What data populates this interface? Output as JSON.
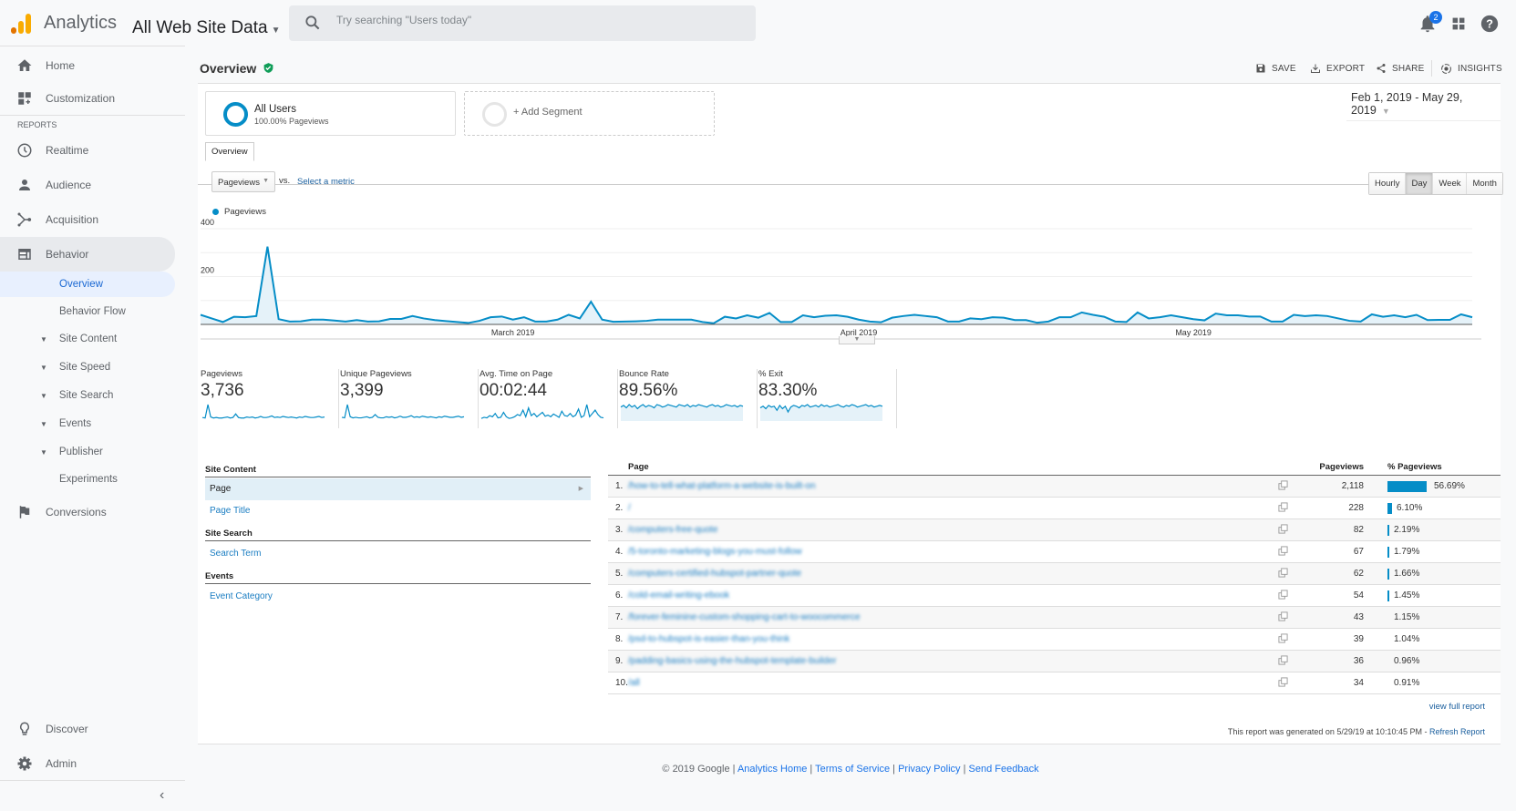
{
  "topbar": {
    "app_name": "Analytics",
    "view_name": "All Web Site Data",
    "search_placeholder": "Try searching \"Users today\"",
    "notification_count": "2",
    "icons": [
      "bell-icon",
      "apps-grid-icon",
      "help-icon"
    ]
  },
  "sidebar": {
    "top_items": [
      {
        "label": "Home",
        "icon": "home-icon"
      },
      {
        "label": "Customization",
        "icon": "dashboard-plus-icon"
      }
    ],
    "reports_label": "REPORTS",
    "report_items": [
      {
        "label": "Realtime",
        "icon": "clock-icon"
      },
      {
        "label": "Audience",
        "icon": "person-icon"
      },
      {
        "label": "Acquisition",
        "icon": "fork-icon"
      },
      {
        "label": "Behavior",
        "icon": "layout-icon"
      }
    ],
    "behavior_sub": [
      {
        "label": "Overview",
        "active": true
      },
      {
        "label": "Behavior Flow"
      }
    ],
    "behavior_groups": [
      "Site Content",
      "Site Speed",
      "Site Search",
      "Events",
      "Publisher"
    ],
    "experiments_label": "Experiments",
    "conversions_label": "Conversions",
    "bottom_items": [
      {
        "label": "Discover",
        "icon": "lightbulb-icon"
      },
      {
        "label": "Admin",
        "icon": "gear-icon"
      }
    ]
  },
  "header": {
    "title": "Overview",
    "actions": [
      {
        "label": "SAVE",
        "icon": "save-icon"
      },
      {
        "label": "EXPORT",
        "icon": "export-icon"
      },
      {
        "label": "SHARE",
        "icon": "share-icon"
      },
      {
        "label": "INSIGHTS",
        "icon": "insights-icon"
      }
    ]
  },
  "segments": {
    "active": {
      "name": "All Users",
      "detail": "100.00% Pageviews",
      "color": "#058dc7"
    },
    "add_label": "+ Add Segment"
  },
  "date_range": "Feb 1, 2019 - May 29, 2019",
  "tab_label": "Overview",
  "metric_selector": {
    "selected": "Pageviews",
    "vs": "vs.",
    "select_metric": "Select a metric"
  },
  "granularity": {
    "options": [
      "Hourly",
      "Day",
      "Week",
      "Month"
    ],
    "selected": "Day"
  },
  "chart_data": {
    "type": "area",
    "title": "",
    "legend": [
      "Pageviews"
    ],
    "legend_position": "top-left",
    "series_color": "#058dc7",
    "ylim": [
      0,
      400
    ],
    "yticks": [
      "400",
      "200"
    ],
    "xticks": [
      "March 2019",
      "April 2019",
      "May 2019"
    ],
    "xtick_indices": [
      28,
      59,
      89
    ],
    "grid": true,
    "series": [
      {
        "name": "Pageviews",
        "values": [
          40,
          25,
          10,
          32,
          30,
          35,
          325,
          22,
          12,
          13,
          20,
          20,
          16,
          12,
          18,
          12,
          13,
          23,
          23,
          35,
          25,
          18,
          14,
          10,
          6,
          15,
          30,
          33,
          20,
          30,
          12,
          12,
          20,
          40,
          25,
          95,
          20,
          11,
          12,
          13,
          15,
          20,
          20,
          20,
          20,
          10,
          5,
          32,
          25,
          38,
          28,
          48,
          10,
          10,
          38,
          30,
          36,
          38,
          32,
          20,
          12,
          9,
          28,
          35,
          40,
          35,
          30,
          12,
          12,
          25,
          22,
          30,
          28,
          18,
          18,
          7,
          12,
          30,
          30,
          50,
          40,
          32,
          12,
          10,
          50,
          25,
          30,
          38,
          30,
          22,
          17,
          45,
          38,
          38,
          33,
          33,
          12,
          12,
          40,
          35,
          38,
          35,
          25,
          15,
          12,
          42,
          32,
          38,
          30,
          40,
          18,
          19,
          19,
          42,
          30
        ]
      }
    ]
  },
  "scorecards": [
    {
      "label": "Pageviews",
      "value": "3,736",
      "spark": [
        5,
        4,
        30,
        6,
        4,
        5,
        4,
        4,
        5,
        6,
        4,
        5,
        12,
        5,
        4,
        4,
        6,
        5,
        6,
        4,
        5,
        7,
        5,
        5,
        6,
        8,
        5,
        6,
        5,
        7,
        6,
        5,
        6,
        5,
        4,
        6,
        5,
        7,
        6,
        5,
        5,
        6,
        7,
        5,
        6
      ],
      "fill": false
    },
    {
      "label": "Unique Pageviews",
      "value": "3,399",
      "spark": [
        5,
        4,
        28,
        6,
        4,
        5,
        4,
        4,
        5,
        6,
        4,
        5,
        10,
        5,
        4,
        4,
        6,
        5,
        6,
        4,
        5,
        7,
        5,
        5,
        6,
        8,
        5,
        6,
        5,
        7,
        6,
        5,
        6,
        5,
        4,
        6,
        5,
        7,
        6,
        5,
        5,
        6,
        7,
        5,
        6
      ],
      "fill": false
    },
    {
      "label": "Avg. Time on Page",
      "value": "00:02:44",
      "spark": [
        3,
        5,
        4,
        8,
        6,
        12,
        4,
        5,
        14,
        6,
        3,
        4,
        6,
        10,
        8,
        18,
        6,
        22,
        8,
        12,
        6,
        10,
        14,
        7,
        9,
        6,
        11,
        8,
        5,
        16,
        8,
        7,
        12,
        6,
        9,
        20,
        5,
        8,
        28,
        6,
        12,
        18,
        10,
        5,
        4
      ],
      "fill": false
    },
    {
      "label": "Bounce Rate",
      "value": "89.56%",
      "spark": [
        16,
        18,
        15,
        19,
        16,
        18,
        14,
        17,
        19,
        16,
        18,
        17,
        15,
        19,
        18,
        16,
        17,
        19,
        18,
        17,
        16,
        19,
        18,
        17,
        19,
        16,
        18,
        17,
        19,
        18,
        17,
        16,
        18,
        19,
        17,
        18,
        16,
        17,
        19,
        18,
        17,
        18,
        16,
        18,
        17
      ],
      "fill": true
    },
    {
      "label": "% Exit",
      "value": "83.30%",
      "spark": [
        15,
        17,
        14,
        18,
        16,
        17,
        12,
        18,
        14,
        17,
        10,
        16,
        18,
        17,
        15,
        18,
        17,
        19,
        16,
        17,
        18,
        16,
        19,
        17,
        18,
        16,
        17,
        18,
        19,
        17,
        16,
        18,
        17,
        19,
        18,
        16,
        17,
        18,
        19,
        17,
        18,
        16,
        17,
        18,
        17
      ],
      "fill": true
    }
  ],
  "dimensions": {
    "groups": [
      {
        "heading": "Site Content",
        "items": [
          {
            "label": "Page",
            "selected": true
          },
          {
            "label": "Page Title"
          }
        ]
      },
      {
        "heading": "Site Search",
        "items": [
          {
            "label": "Search Term"
          }
        ]
      },
      {
        "heading": "Events",
        "items": [
          {
            "label": "Event Category"
          }
        ]
      }
    ]
  },
  "table": {
    "columns": [
      "Page",
      "Pageviews",
      "% Pageviews"
    ],
    "rows": [
      {
        "rank": "1.",
        "page": "/how-to-tell-what-platform-a-website-is-built-on",
        "pageviews": "2,118",
        "pct": "56.69%",
        "share": 56.69
      },
      {
        "rank": "2.",
        "page": "/",
        "pageviews": "228",
        "pct": "6.10%",
        "share": 6.1
      },
      {
        "rank": "3.",
        "page": "/computers-free-quote",
        "pageviews": "82",
        "pct": "2.19%",
        "share": 2.19
      },
      {
        "rank": "4.",
        "page": "/5-toronto-marketing-blogs-you-must-follow",
        "pageviews": "67",
        "pct": "1.79%",
        "share": 1.79
      },
      {
        "rank": "5.",
        "page": "/computers-certified-hubspot-partner-quote",
        "pageviews": "62",
        "pct": "1.66%",
        "share": 1.66
      },
      {
        "rank": "6.",
        "page": "/cold-email-writing-ebook",
        "pageviews": "54",
        "pct": "1.45%",
        "share": 1.45
      },
      {
        "rank": "7.",
        "page": "/forever-feminine-custom-shopping-cart-to-woocommerce",
        "pageviews": "43",
        "pct": "1.15%",
        "share": 1.15
      },
      {
        "rank": "8.",
        "page": "/psd-to-hubspot-is-easier-than-you-think",
        "pageviews": "39",
        "pct": "1.04%",
        "share": 1.04
      },
      {
        "rank": "9.",
        "page": "/padding-basics-using-the-hubspot-template-builder",
        "pageviews": "36",
        "pct": "0.96%",
        "share": 0.96
      },
      {
        "rank": "10.",
        "page": "/all",
        "pageviews": "34",
        "pct": "0.91%",
        "share": 0.91
      }
    ],
    "view_full_report": "view full report",
    "generated_text": "This report was generated on 5/29/19 at 10:10:45 PM - ",
    "refresh_label": "Refresh Report"
  },
  "footer": {
    "copyright": "© 2019 Google",
    "links": [
      "Analytics Home",
      "Terms of Service",
      "Privacy Policy",
      "Send Feedback"
    ]
  }
}
